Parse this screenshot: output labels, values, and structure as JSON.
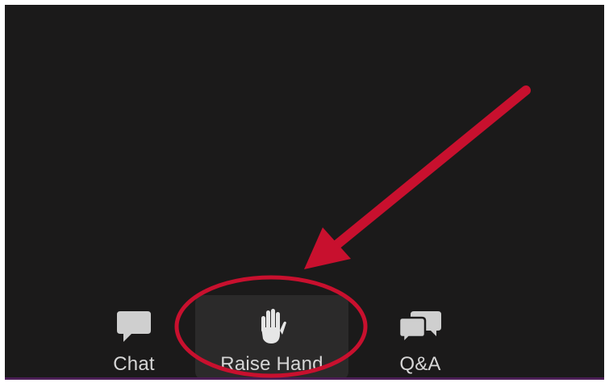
{
  "toolbar": {
    "chat": {
      "label": "Chat",
      "icon": "chat-bubble-icon"
    },
    "raise_hand": {
      "label": "Raise Hand",
      "icon": "raised-hand-icon"
    },
    "qa": {
      "label": "Q&A",
      "icon": "qa-bubbles-icon"
    }
  },
  "annotation": {
    "type": "arrow-and-circle",
    "color": "#c8102e",
    "target": "raise_hand"
  },
  "colors": {
    "meeting_background": "#1b1a1a",
    "bottom_strip": "#4b1e55",
    "icon_color": "#cfcfcf",
    "label_color": "#d6d6d6"
  }
}
